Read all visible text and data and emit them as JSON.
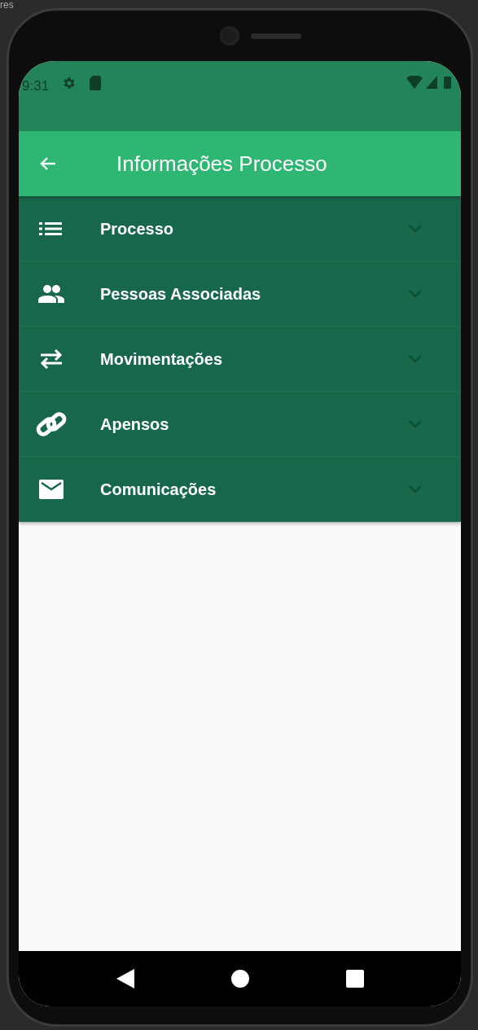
{
  "host_label": "res",
  "status_bar": {
    "time": "9:31"
  },
  "app_bar": {
    "title": "Informações Processo"
  },
  "sections": [
    {
      "label": "Processo",
      "kind": "list",
      "expanded": false
    },
    {
      "label": "Pessoas Associadas",
      "kind": "people",
      "expanded": false
    },
    {
      "label": "Movimentações",
      "kind": "swap",
      "expanded": false
    },
    {
      "label": "Apensos",
      "kind": "link",
      "expanded": false
    },
    {
      "label": "Comunicações",
      "kind": "mail",
      "expanded": false
    }
  ]
}
